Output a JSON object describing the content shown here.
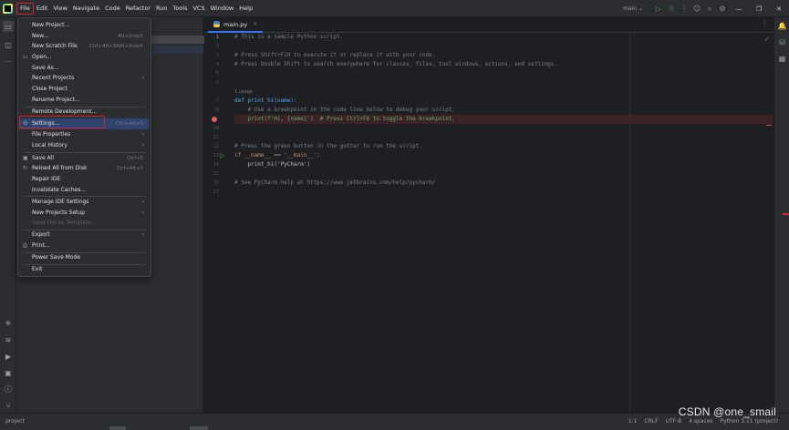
{
  "menubar": {
    "items": [
      "File",
      "Edit",
      "View",
      "Navigate",
      "Code",
      "Refactor",
      "Run",
      "Tools",
      "VCS",
      "Window",
      "Help"
    ]
  },
  "toolbar": {
    "branch": "main ⌄",
    "icons": [
      "run-icon",
      "debug-icon",
      "more-icon",
      "user-icon",
      "search-icon",
      "settings-icon"
    ]
  },
  "window_controls": {
    "minimize": "—",
    "restore": "❐",
    "close": "✕"
  },
  "file_menu": {
    "items": [
      {
        "label": "New Project...",
        "shortcut": "",
        "submenu": false
      },
      {
        "label": "New...",
        "shortcut": "Alt+Insert",
        "submenu": false
      },
      {
        "label": "New Scratch File",
        "shortcut": "Ctrl+Alt+Shift+Insert",
        "submenu": false
      },
      {
        "label": "Open...",
        "shortcut": "",
        "submenu": false,
        "icon": "📁"
      },
      {
        "label": "Save As...",
        "shortcut": "",
        "submenu": false
      },
      {
        "label": "Recent Projects",
        "shortcut": "",
        "submenu": true
      },
      {
        "label": "Close Project",
        "shortcut": "",
        "submenu": false
      },
      {
        "label": "Rename Project...",
        "shortcut": "",
        "submenu": false
      },
      {
        "label": "Remote Development...",
        "shortcut": "",
        "submenu": false
      },
      {
        "label": "Settings...",
        "shortcut": "Ctrl+Alt+S",
        "submenu": false,
        "icon": "⚙"
      },
      {
        "label": "File Properties",
        "shortcut": "",
        "submenu": true
      },
      {
        "label": "Local History",
        "shortcut": "",
        "submenu": true
      },
      {
        "label": "Save All",
        "shortcut": "Ctrl+S",
        "submenu": false,
        "icon": "🖫"
      },
      {
        "label": "Reload All from Disk",
        "shortcut": "Ctrl+Alt+Y",
        "submenu": false,
        "icon": "↻"
      },
      {
        "label": "Repair IDE",
        "shortcut": "",
        "submenu": false
      },
      {
        "label": "Invalidate Caches...",
        "shortcut": "",
        "submenu": false
      },
      {
        "label": "Manage IDE Settings",
        "shortcut": "",
        "submenu": true
      },
      {
        "label": "New Projects Setup",
        "shortcut": "",
        "submenu": true
      },
      {
        "label": "Save File as Template...",
        "shortcut": "",
        "submenu": false,
        "disabled": true
      },
      {
        "label": "Export",
        "shortcut": "",
        "submenu": true
      },
      {
        "label": "Print...",
        "shortcut": "",
        "submenu": false,
        "icon": "⎙"
      },
      {
        "label": "Power Save Mode",
        "shortcut": "",
        "submenu": false
      },
      {
        "label": "Exit",
        "shortcut": "",
        "submenu": false
      }
    ],
    "selected": "Settings..."
  },
  "editor": {
    "tab": {
      "label": "main.py",
      "close": "×"
    },
    "usage_hint": "1 usage",
    "lines": [
      {
        "n": "1",
        "text": "# This is a sample Python script."
      },
      {
        "n": "2",
        "text": ""
      },
      {
        "n": "3",
        "text": "# Press Shift+F10 to execute it or replace it with your code."
      },
      {
        "n": "4",
        "text": "# Press Double Shift to search everywhere for classes, files, tool windows, actions, and settings."
      },
      {
        "n": "5",
        "text": ""
      },
      {
        "n": "6",
        "text": ""
      },
      {
        "n": "7",
        "text": "def print_hi(name):"
      },
      {
        "n": "8",
        "text": "    # Use a breakpoint in the code line below to debug your script."
      },
      {
        "n": "9",
        "text": "    print(f'Hi, {name}')  # Press Ctrl+F8 to toggle the breakpoint."
      },
      {
        "n": "10",
        "text": ""
      },
      {
        "n": "11",
        "text": ""
      },
      {
        "n": "12",
        "text": "# Press the green button in the gutter to run the script."
      },
      {
        "n": "13",
        "text": "if __name__ == '__main__':"
      },
      {
        "n": "14",
        "text": "    print_hi('PyCharm')"
      },
      {
        "n": "15",
        "text": ""
      },
      {
        "n": "16",
        "text": "# See PyCharm help at https://www.jetbrains.com/help/pycharm/"
      },
      {
        "n": "17",
        "text": ""
      }
    ]
  },
  "statusbar": {
    "left": "project",
    "items": [
      "1:1",
      "CRLF",
      "UTF-8",
      "4 spaces",
      "Python 3.11 (project)"
    ]
  },
  "watermark": "CSDN @one_smail"
}
